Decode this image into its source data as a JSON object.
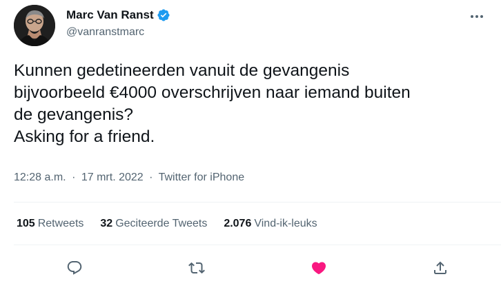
{
  "author": {
    "name": "Marc Van Ranst",
    "handle": "@vanranstmarc",
    "verified": true
  },
  "tweet": {
    "text": "Kunnen gedetineerden vanuit de gevangenis\nbijvoorbeeld €4000 overschrijven naar iemand buiten\nde gevangenis?\nAsking for a friend.",
    "time": "12:28 a.m.",
    "separator": "·",
    "date": "17 mrt. 2022",
    "source": "Twitter for iPhone"
  },
  "stats": {
    "retweets_count": "105",
    "retweets_label": "Retweets",
    "quotes_count": "32",
    "quotes_label": "Geciteerde Tweets",
    "likes_count": "2.076",
    "likes_label": "Vind-ik-leuks"
  },
  "actions": {
    "reply_icon": "reply-icon",
    "retweet_icon": "retweet-icon",
    "like_icon": "heart-filled-icon",
    "share_icon": "share-icon"
  },
  "colors": {
    "text_primary": "#0f1419",
    "text_secondary": "#536471",
    "verified_blue": "#1d9bf0",
    "like_pink": "#f91880",
    "divider": "#eff3f4"
  }
}
